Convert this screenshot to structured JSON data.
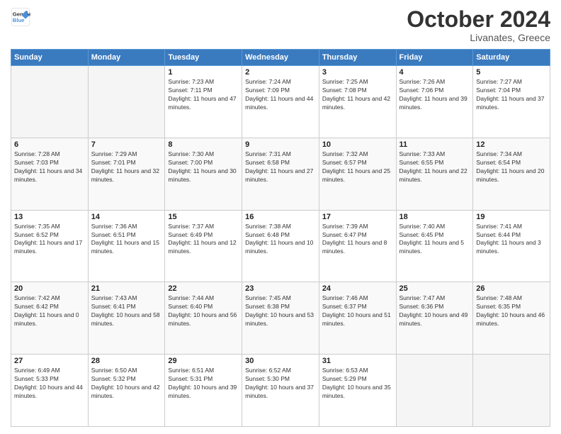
{
  "header": {
    "logo_line1": "General",
    "logo_line2": "Blue",
    "month": "October 2024",
    "location": "Livanates, Greece"
  },
  "weekdays": [
    "Sunday",
    "Monday",
    "Tuesday",
    "Wednesday",
    "Thursday",
    "Friday",
    "Saturday"
  ],
  "weeks": [
    [
      {
        "day": "",
        "info": ""
      },
      {
        "day": "",
        "info": ""
      },
      {
        "day": "1",
        "info": "Sunrise: 7:23 AM\nSunset: 7:11 PM\nDaylight: 11 hours and 47 minutes."
      },
      {
        "day": "2",
        "info": "Sunrise: 7:24 AM\nSunset: 7:09 PM\nDaylight: 11 hours and 44 minutes."
      },
      {
        "day": "3",
        "info": "Sunrise: 7:25 AM\nSunset: 7:08 PM\nDaylight: 11 hours and 42 minutes."
      },
      {
        "day": "4",
        "info": "Sunrise: 7:26 AM\nSunset: 7:06 PM\nDaylight: 11 hours and 39 minutes."
      },
      {
        "day": "5",
        "info": "Sunrise: 7:27 AM\nSunset: 7:04 PM\nDaylight: 11 hours and 37 minutes."
      }
    ],
    [
      {
        "day": "6",
        "info": "Sunrise: 7:28 AM\nSunset: 7:03 PM\nDaylight: 11 hours and 34 minutes."
      },
      {
        "day": "7",
        "info": "Sunrise: 7:29 AM\nSunset: 7:01 PM\nDaylight: 11 hours and 32 minutes."
      },
      {
        "day": "8",
        "info": "Sunrise: 7:30 AM\nSunset: 7:00 PM\nDaylight: 11 hours and 30 minutes."
      },
      {
        "day": "9",
        "info": "Sunrise: 7:31 AM\nSunset: 6:58 PM\nDaylight: 11 hours and 27 minutes."
      },
      {
        "day": "10",
        "info": "Sunrise: 7:32 AM\nSunset: 6:57 PM\nDaylight: 11 hours and 25 minutes."
      },
      {
        "day": "11",
        "info": "Sunrise: 7:33 AM\nSunset: 6:55 PM\nDaylight: 11 hours and 22 minutes."
      },
      {
        "day": "12",
        "info": "Sunrise: 7:34 AM\nSunset: 6:54 PM\nDaylight: 11 hours and 20 minutes."
      }
    ],
    [
      {
        "day": "13",
        "info": "Sunrise: 7:35 AM\nSunset: 6:52 PM\nDaylight: 11 hours and 17 minutes."
      },
      {
        "day": "14",
        "info": "Sunrise: 7:36 AM\nSunset: 6:51 PM\nDaylight: 11 hours and 15 minutes."
      },
      {
        "day": "15",
        "info": "Sunrise: 7:37 AM\nSunset: 6:49 PM\nDaylight: 11 hours and 12 minutes."
      },
      {
        "day": "16",
        "info": "Sunrise: 7:38 AM\nSunset: 6:48 PM\nDaylight: 11 hours and 10 minutes."
      },
      {
        "day": "17",
        "info": "Sunrise: 7:39 AM\nSunset: 6:47 PM\nDaylight: 11 hours and 8 minutes."
      },
      {
        "day": "18",
        "info": "Sunrise: 7:40 AM\nSunset: 6:45 PM\nDaylight: 11 hours and 5 minutes."
      },
      {
        "day": "19",
        "info": "Sunrise: 7:41 AM\nSunset: 6:44 PM\nDaylight: 11 hours and 3 minutes."
      }
    ],
    [
      {
        "day": "20",
        "info": "Sunrise: 7:42 AM\nSunset: 6:42 PM\nDaylight: 11 hours and 0 minutes."
      },
      {
        "day": "21",
        "info": "Sunrise: 7:43 AM\nSunset: 6:41 PM\nDaylight: 10 hours and 58 minutes."
      },
      {
        "day": "22",
        "info": "Sunrise: 7:44 AM\nSunset: 6:40 PM\nDaylight: 10 hours and 56 minutes."
      },
      {
        "day": "23",
        "info": "Sunrise: 7:45 AM\nSunset: 6:38 PM\nDaylight: 10 hours and 53 minutes."
      },
      {
        "day": "24",
        "info": "Sunrise: 7:46 AM\nSunset: 6:37 PM\nDaylight: 10 hours and 51 minutes."
      },
      {
        "day": "25",
        "info": "Sunrise: 7:47 AM\nSunset: 6:36 PM\nDaylight: 10 hours and 49 minutes."
      },
      {
        "day": "26",
        "info": "Sunrise: 7:48 AM\nSunset: 6:35 PM\nDaylight: 10 hours and 46 minutes."
      }
    ],
    [
      {
        "day": "27",
        "info": "Sunrise: 6:49 AM\nSunset: 5:33 PM\nDaylight: 10 hours and 44 minutes."
      },
      {
        "day": "28",
        "info": "Sunrise: 6:50 AM\nSunset: 5:32 PM\nDaylight: 10 hours and 42 minutes."
      },
      {
        "day": "29",
        "info": "Sunrise: 6:51 AM\nSunset: 5:31 PM\nDaylight: 10 hours and 39 minutes."
      },
      {
        "day": "30",
        "info": "Sunrise: 6:52 AM\nSunset: 5:30 PM\nDaylight: 10 hours and 37 minutes."
      },
      {
        "day": "31",
        "info": "Sunrise: 6:53 AM\nSunset: 5:29 PM\nDaylight: 10 hours and 35 minutes."
      },
      {
        "day": "",
        "info": ""
      },
      {
        "day": "",
        "info": ""
      }
    ]
  ]
}
